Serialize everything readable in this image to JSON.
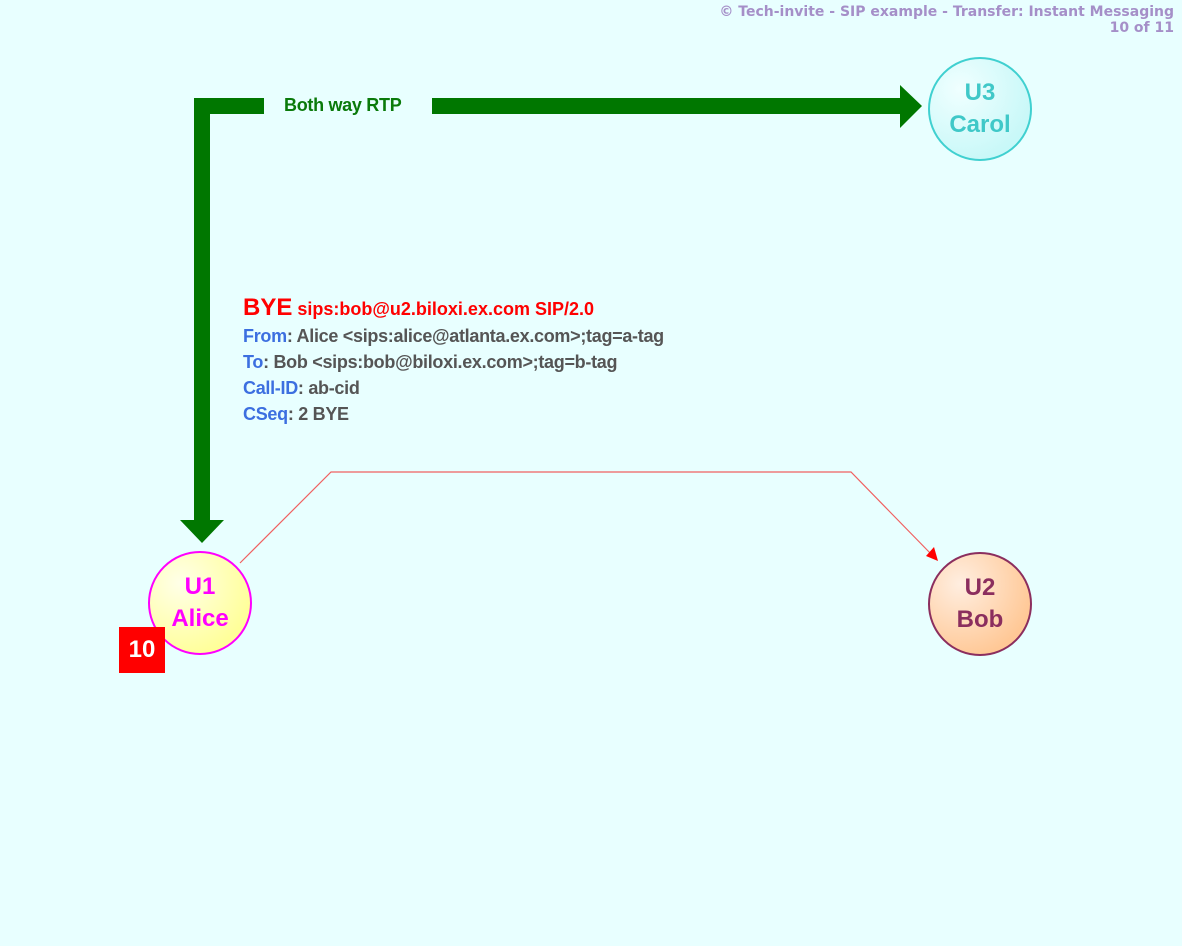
{
  "header": {
    "title": "© Tech-invite - SIP example - Transfer: Instant Messaging",
    "page": "10 of 11"
  },
  "rtp": {
    "label": "Both way RTP",
    "color": "#007700"
  },
  "message": {
    "method": "BYE",
    "request_uri": "sips:bob@u2.biloxi.ex.com SIP/2.0",
    "headers": [
      {
        "name": "From",
        "value": "Alice <sips:alice@atlanta.ex.com>;tag=a-tag"
      },
      {
        "name": "To",
        "value": "Bob <sips:bob@biloxi.ex.com>;tag=b-tag"
      },
      {
        "name": "Call-ID",
        "value": "ab-cid"
      },
      {
        "name": "CSeq",
        "value": "2 BYE"
      }
    ],
    "arrow_color": "#ff0000"
  },
  "nodes": {
    "alice": {
      "id": "U1",
      "name": "Alice"
    },
    "bob": {
      "id": "U2",
      "name": "Bob"
    },
    "carol": {
      "id": "U3",
      "name": "Carol"
    }
  },
  "step": "10"
}
